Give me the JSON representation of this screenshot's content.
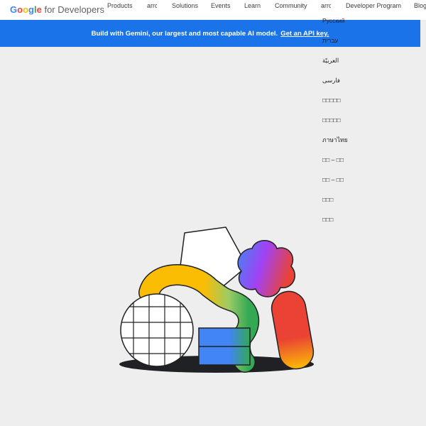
{
  "header": {
    "logo_google": "Google",
    "logo_rest": " for Developers",
    "nav": {
      "products": "Products",
      "arr1": "arrc",
      "solutions": "Solutions",
      "events": "Events",
      "learn": "Learn",
      "community": "Community",
      "arr2": "arrc",
      "program": "Developer Program",
      "blog": "Blog"
    }
  },
  "banner": {
    "text": "Build with Gemini, our largest and most capable AI model.",
    "link": "Get an API key."
  },
  "languages": [
    "Русский",
    "עברית",
    "العربيّة",
    "فارسی",
    "□□□□□",
    "□□□□□",
    "ภาษาไทย",
    "□□ – □□",
    "□□ – □□",
    "□□□",
    "□□□"
  ],
  "colors": {
    "banner": "#1a73e8",
    "google_blue": "#4285f4",
    "google_red": "#ea4335",
    "google_yellow": "#fbbc04",
    "google_green": "#34a853"
  }
}
